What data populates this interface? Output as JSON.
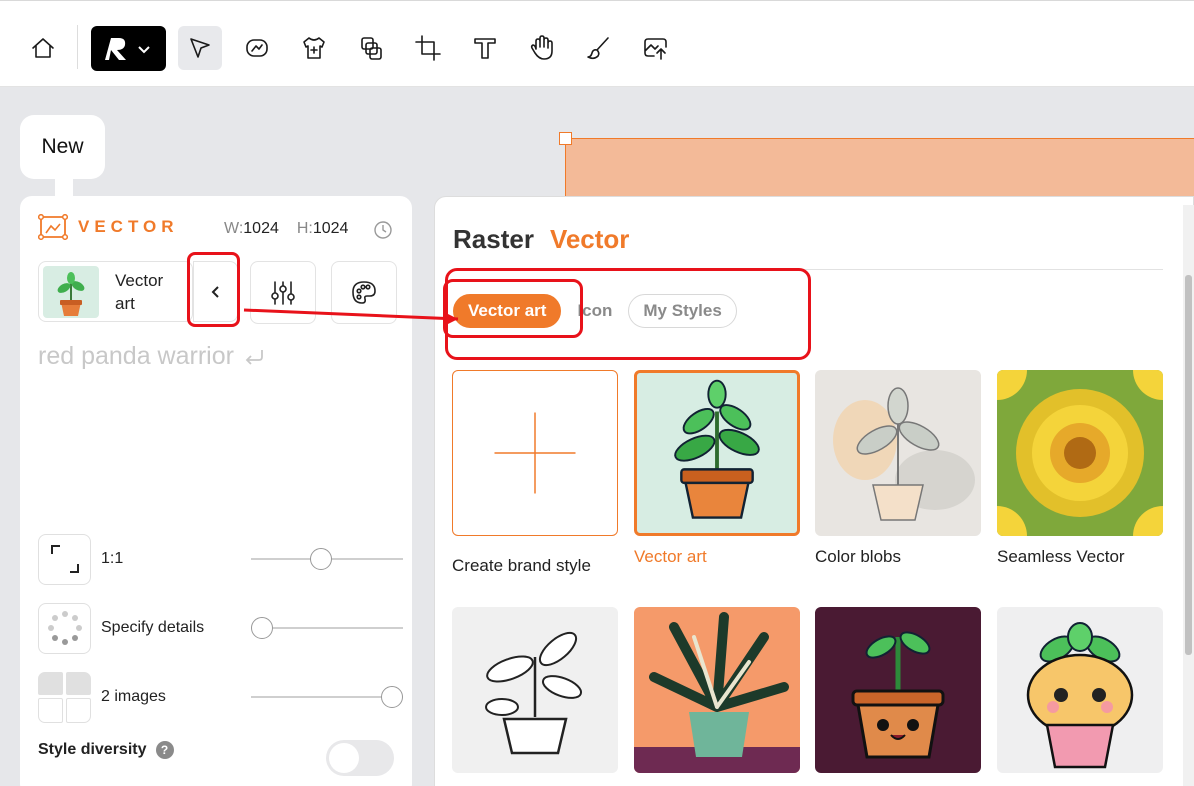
{
  "toolbar": {
    "tools": [
      "home",
      "logo-menu",
      "select",
      "generate-image",
      "mockup",
      "layers",
      "crop",
      "text",
      "hand",
      "brush",
      "export"
    ]
  },
  "new_tab": {
    "label": "New"
  },
  "panel": {
    "mode_title": "VECTOR",
    "width_key": "W:",
    "width_value": "1024",
    "height_key": "H:",
    "height_value": "1024",
    "style_name": "Vector art",
    "prompt": "red panda warrior",
    "options": [
      {
        "label": "1:1",
        "level": 0.45
      },
      {
        "label": "Specify details",
        "level": 0.0
      },
      {
        "label": "2 images",
        "level": 1.0
      }
    ],
    "diversity_label": "Style diversity",
    "help": "?"
  },
  "style_panel": {
    "tabs": [
      "Raster",
      "Vector"
    ],
    "active_tab": "Vector",
    "chips": [
      "Vector art",
      "Icon",
      "My Styles"
    ],
    "active_chip": "Vector art",
    "tiles": [
      {
        "label": "Create brand style"
      },
      {
        "label": "Vector art",
        "selected": true
      },
      {
        "label": "Color blobs"
      },
      {
        "label": "Seamless Vector"
      }
    ]
  },
  "colors": {
    "accent": "#f07a2a",
    "annotation": "#e8121a"
  }
}
